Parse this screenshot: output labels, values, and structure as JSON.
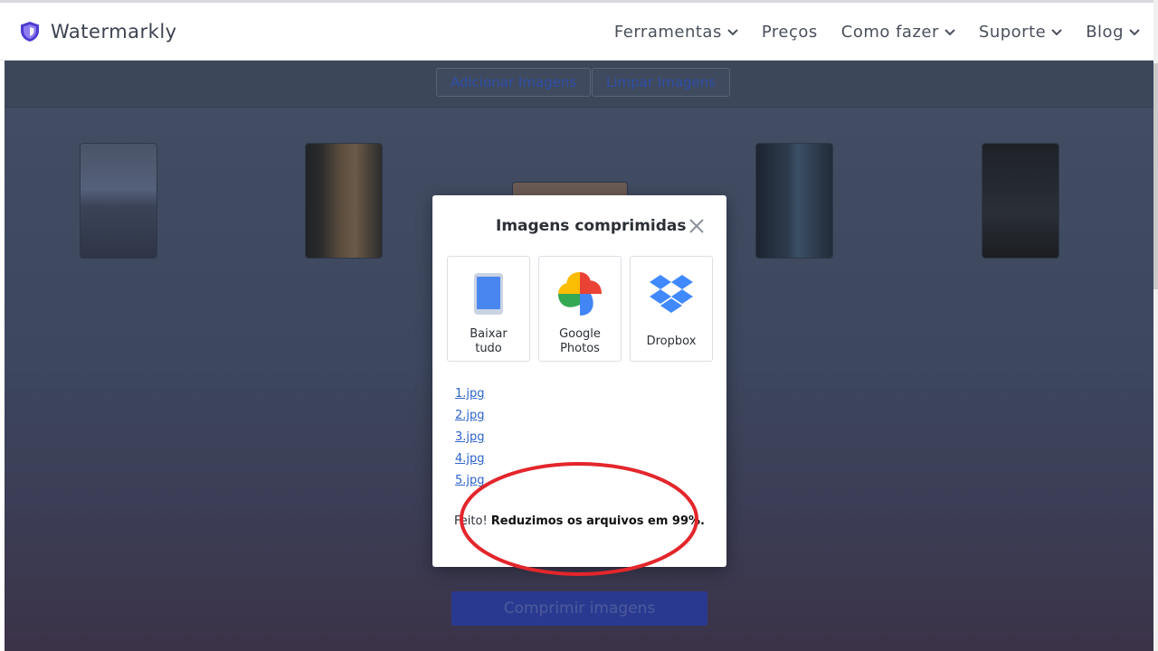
{
  "header": {
    "brand": "Watermarkly",
    "nav": [
      {
        "label": "Ferramentas",
        "dropdown": true
      },
      {
        "label": "Preços",
        "dropdown": false
      },
      {
        "label": "Como fazer",
        "dropdown": true
      },
      {
        "label": "Suporte",
        "dropdown": true
      },
      {
        "label": "Blog",
        "dropdown": true
      }
    ]
  },
  "toolbar": {
    "add_label": "Adicionar Imagens",
    "clear_label": "Limpar Imagens"
  },
  "main": {
    "compress_label": "Comprimir imagens"
  },
  "modal": {
    "title": "Imagens comprimidas",
    "options": [
      {
        "line1": "Baixar",
        "line2": "tudo",
        "icon": "device-download-icon"
      },
      {
        "line1": "Google",
        "line2": "Photos",
        "icon": "google-photos-icon"
      },
      {
        "line1": "Dropbox",
        "line2": "",
        "icon": "dropbox-icon"
      }
    ],
    "files": [
      "1.jpg",
      "2.jpg",
      "3.jpg",
      "4.jpg",
      "5.jpg"
    ],
    "status_prefix": "Feito!",
    "status_bold": "Reduzimos os arquivos em 99%."
  },
  "colors": {
    "accent": "#2d63c9",
    "annotation": "#e3262c",
    "brand_shield": "#5b3fd6"
  }
}
